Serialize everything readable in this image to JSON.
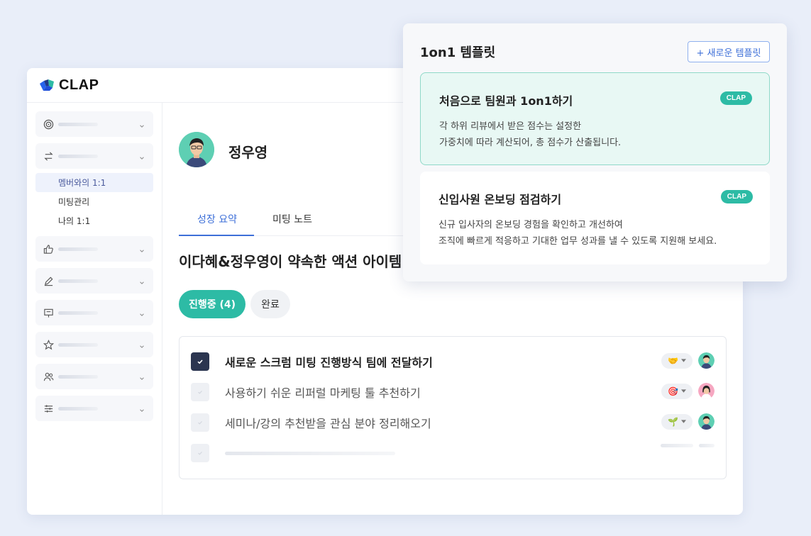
{
  "app": {
    "logo_text": "CLAP",
    "brand_colors": {
      "accent_teal": "#2dbba5",
      "accent_blue": "#3d6fd8",
      "dark": "#2b3550"
    }
  },
  "sidebar": {
    "groups": [
      {
        "icon": "target-icon"
      },
      {
        "icon": "exchange-icon",
        "expanded": true
      },
      {
        "icon": "thumbs-up-icon"
      },
      {
        "icon": "pen-icon"
      },
      {
        "icon": "presentation-icon"
      },
      {
        "icon": "star-icon"
      },
      {
        "icon": "people-icon"
      },
      {
        "icon": "sliders-icon"
      }
    ],
    "sub_items": [
      {
        "label": "멤버와의 1:1",
        "active": true
      },
      {
        "label": "미팅관리"
      },
      {
        "label": "나의 1:1"
      }
    ]
  },
  "profile": {
    "name": "정우영"
  },
  "tabs": [
    {
      "label": "성장 요약",
      "active": true
    },
    {
      "label": "미팅 노트"
    }
  ],
  "section_title": "이다혜&정우영이 약속한 액션 아이템",
  "filters": {
    "in_progress": "진행중 (4)",
    "done": "완료"
  },
  "action_items": [
    {
      "text": "새로운 스크럼 미팅 진행방식 팀에 전달하기",
      "checked": true,
      "emoji": "🤝"
    },
    {
      "text": "사용하기 쉬운 리퍼럴 마케팅 툴 추천하기",
      "checked": false,
      "emoji": "🎯"
    },
    {
      "text": "세미나/강의 추천받을 관심 분야 정리해오기",
      "checked": false,
      "emoji": "🌱"
    }
  ],
  "popup": {
    "title": "1on1 템플릿",
    "new_button": "+ 새로운 템플릿",
    "templates": [
      {
        "name": "처음으로 팀원과 1on1하기",
        "badge": "CLAP",
        "desc_line1": "각 하위 리뷰에서 받은 점수는 설정한",
        "desc_line2": "가중치에 따라 계산되어, 총 점수가 산출됩니다.",
        "selected": true
      },
      {
        "name": "신입사원 온보딩 점검하기",
        "badge": "CLAP",
        "desc_line1": "신규 입사자의 온보딩 경험을 확인하고 개선하여",
        "desc_line2": "조직에 빠르게 적응하고 기대한 업무 성과를 낼 수 있도록 지원해 보세요."
      }
    ]
  }
}
